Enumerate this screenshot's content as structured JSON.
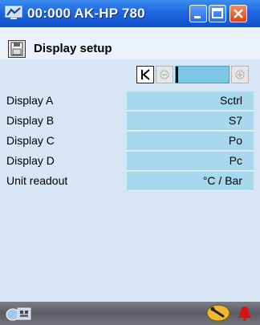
{
  "window": {
    "title": "00:000 AK-HP 780"
  },
  "header": {
    "title": "Display setup"
  },
  "rows": [
    {
      "label": "Display A",
      "value": "Sctrl"
    },
    {
      "label": "Display B",
      "value": "S7"
    },
    {
      "label": "Display C",
      "value": "Po"
    },
    {
      "label": "Display D",
      "value": "Pc"
    },
    {
      "label": "Unit readout",
      "value": "°C / Bar"
    }
  ],
  "icons": {
    "app": "monitor-icon",
    "window_minimize": "minimize-icon",
    "window_maximize": "maximize-icon",
    "window_close": "close-icon",
    "header": "floppy-disk-icon",
    "nav_first": "first-page-icon",
    "nav_prev": "minus-icon",
    "nav_next": "plus-icon",
    "bottom_left": "network-icon",
    "tool": "wrench-icon",
    "alarm": "bell-icon"
  },
  "colors": {
    "titlebar": "#1f66e0",
    "background": "#d6e6f5",
    "value_cell": "#a8d8ee",
    "nav_bar": "#7ec8e6",
    "alarm": "#e01010"
  }
}
